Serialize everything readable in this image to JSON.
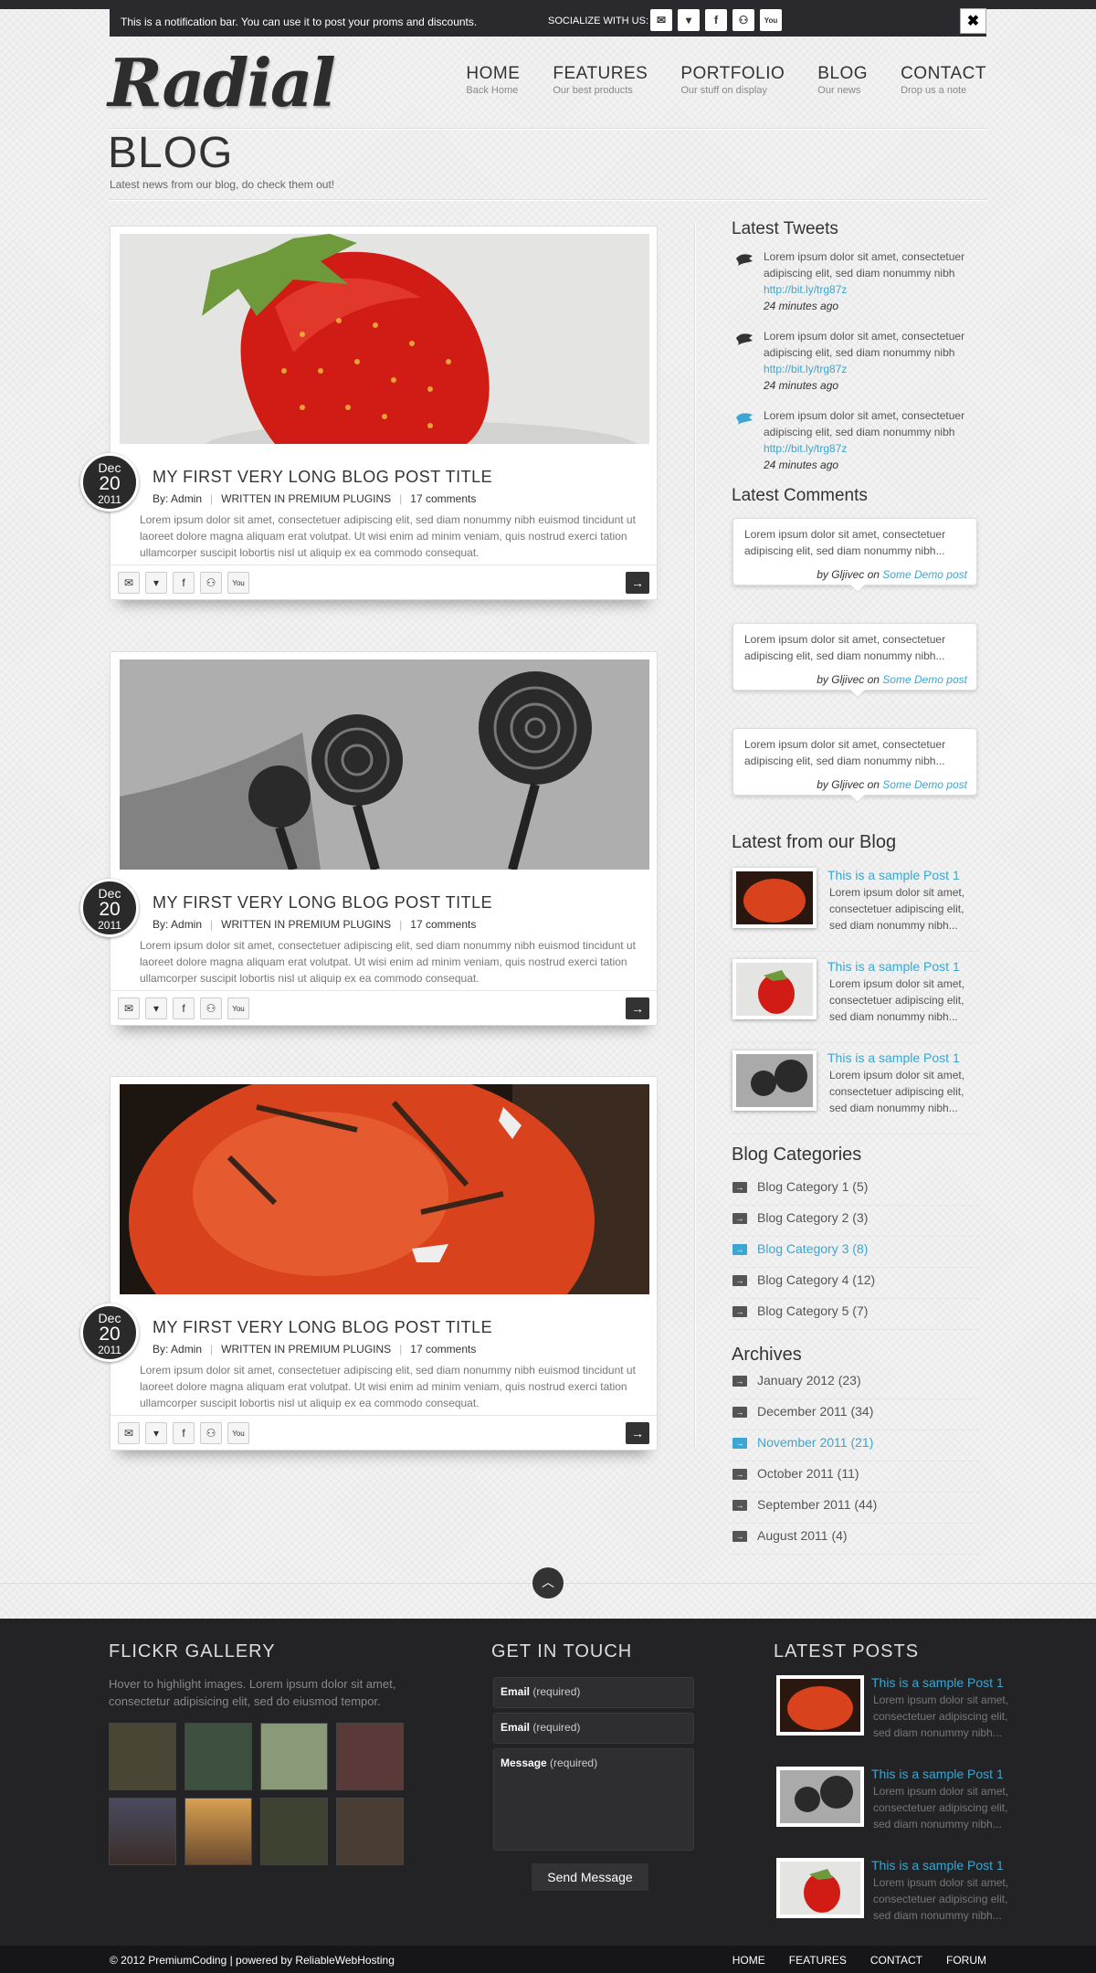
{
  "notification": {
    "text": "This is a notification bar. You can use it to post your proms and discounts.",
    "social_label": "SOCIALIZE WITH US:",
    "close": "✖"
  },
  "logo": "Radial",
  "nav": [
    {
      "title": "HOME",
      "sub": "Back Home"
    },
    {
      "title": "FEATURES",
      "sub": "Our best products"
    },
    {
      "title": "PORTFOLIO",
      "sub": "Our stuff on display"
    },
    {
      "title": "BLOG",
      "sub": "Our news"
    },
    {
      "title": "CONTACT",
      "sub": "Drop us a note"
    }
  ],
  "page": {
    "title": "BLOG",
    "subtitle": "Latest news from our blog, do check them out!"
  },
  "posts": [
    {
      "month": "Dec",
      "day": "20",
      "year": "2011",
      "title": "MY FIRST VERY LONG BLOG POST TITLE",
      "author": "By: Admin",
      "category": "WRITTEN IN PREMIUM PLUGINS",
      "comments": "17 comments",
      "excerpt": "Lorem ipsum dolor sit amet, consectetuer adipiscing elit, sed diam nonummy nibh euismod tincidunt ut laoreet dolore magna aliquam erat volutpat. Ut wisi enim ad minim veniam, quis nostrud exerci tation ullamcorper suscipit lobortis nisl ut aliquip ex ea commodo consequat.",
      "image": "strawberry"
    },
    {
      "month": "Dec",
      "day": "20",
      "year": "2011",
      "title": "MY FIRST VERY LONG BLOG POST TITLE",
      "author": "By: Admin",
      "category": "WRITTEN IN PREMIUM PLUGINS",
      "comments": "17 comments",
      "excerpt": "Lorem ipsum dolor sit amet, consectetuer adipiscing elit, sed diam nonummy nibh euismod tincidunt ut laoreet dolore magna aliquam erat volutpat. Ut wisi enim ad minim veniam, quis nostrud exerci tation ullamcorper suscipit lobortis nisl ut aliquip ex ea commodo consequat.",
      "image": "roses"
    },
    {
      "month": "Dec",
      "day": "20",
      "year": "2011",
      "title": "MY FIRST VERY LONG BLOG POST TITLE",
      "author": "By: Admin",
      "category": "WRITTEN IN PREMIUM PLUGINS",
      "comments": "17 comments",
      "excerpt": "Lorem ipsum dolor sit amet, consectetuer adipiscing elit, sed diam nonummy nibh euismod tincidunt ut laoreet dolore magna aliquam erat volutpat. Ut wisi enim ad minim veniam, quis nostrud exerci tation ullamcorper suscipit lobortis nisl ut aliquip ex ea commodo consequat.",
      "image": "tomato"
    }
  ],
  "sidebar": {
    "tweets_title": "Latest Tweets",
    "tweets": [
      {
        "text": "Lorem ipsum dolor sit amet, consectetuer adipiscing elit, sed diam nonummy nibh",
        "link": "http://bit.ly/trg87z",
        "time": "24 minutes ago"
      },
      {
        "text": "Lorem ipsum dolor sit amet, consectetuer adipiscing elit, sed diam nonummy nibh",
        "link": "http://bit.ly/trg87z",
        "time": "24 minutes ago"
      },
      {
        "text": "Lorem ipsum dolor sit amet, consectetuer adipiscing elit, sed diam nonummy nibh",
        "link": "http://bit.ly/trg87z",
        "time": "24 minutes ago"
      }
    ],
    "comments_title": "Latest Comments",
    "comments": [
      {
        "text": "Lorem ipsum dolor sit amet, consectetuer adipiscing elit, sed diam nonummy nibh...",
        "by": "by Gljivec on",
        "post": "Some Demo post"
      },
      {
        "text": "Lorem ipsum dolor sit amet, consectetuer adipiscing elit, sed diam nonummy nibh...",
        "by": "by Gljivec on",
        "post": "Some Demo post"
      },
      {
        "text": "Lorem ipsum dolor sit amet, consectetuer adipiscing elit, sed diam nonummy nibh...",
        "by": "by Gljivec on",
        "post": "Some Demo post"
      }
    ],
    "blog_title": "Latest from our Blog",
    "blog": [
      {
        "title": "This is a sample Post 1",
        "text": "Lorem ipsum dolor sit amet, consectetuer adipiscing elit, sed diam nonummy nibh...",
        "image": "tomato"
      },
      {
        "title": "This is a sample Post 1",
        "text": "Lorem ipsum dolor sit amet, consectetuer adipiscing elit, sed diam nonummy nibh...",
        "image": "strawberry"
      },
      {
        "title": "This is a sample Post 1",
        "text": "Lorem ipsum dolor sit amet, consectetuer adipiscing elit, sed diam nonummy nibh...",
        "image": "roses"
      }
    ],
    "categories_title": "Blog Categories",
    "categories": [
      {
        "label": "Blog Category 1 (5)",
        "active": false
      },
      {
        "label": "Blog Category 2 (3)",
        "active": false
      },
      {
        "label": "Blog Category 3 (8)",
        "active": true
      },
      {
        "label": "Blog Category 4 (12)",
        "active": false
      },
      {
        "label": "Blog Category 5 (7)",
        "active": false
      }
    ],
    "archives_title": "Archives",
    "archives": [
      {
        "label": "January 2012 (23)",
        "active": false
      },
      {
        "label": "December 2011 (34)",
        "active": false
      },
      {
        "label": "November 2011 (21)",
        "active": true
      },
      {
        "label": "October 2011 (11)",
        "active": false
      },
      {
        "label": "September 2011 (44)",
        "active": false
      },
      {
        "label": "August 2011 (4)",
        "active": false
      }
    ]
  },
  "footer": {
    "flickr_title": "FLICKR GALLERY",
    "flickr_desc": "Hover to highlight images. Lorem ipsum dolor sit amet, consectetur adipisicing elit, sed do eiusmod tempor.",
    "contact_title": "GET IN TOUCH",
    "email1_label": "Email",
    "email1_req": "(required)",
    "email2_label": "Email",
    "email2_req": "(required)",
    "message_label": "Message",
    "message_req": "(required)",
    "send": "Send Message",
    "posts_title": "LATEST POSTS",
    "posts": [
      {
        "title": "This is a sample Post 1",
        "text": "Lorem ipsum dolor sit amet, consectetuer adipiscing elit, sed diam nonummy nibh...",
        "image": "tomato"
      },
      {
        "title": "This is a sample Post 1",
        "text": "Lorem ipsum dolor sit amet, consectetuer adipiscing elit, sed diam nonummy nibh...",
        "image": "roses"
      },
      {
        "title": "This is a sample Post 1",
        "text": "Lorem ipsum dolor sit amet, consectetuer adipiscing elit, sed diam nonummy nibh...",
        "image": "strawberry"
      }
    ],
    "copyright": "© 2012 PremiumCoding | powered by ReliableWebHosting",
    "links": [
      "HOME",
      "FEATURES",
      "CONTACT",
      "FORUM"
    ]
  },
  "colors": {
    "accent": "#3aa6d1",
    "dark": "#232326",
    "twitter": "#3aa6d1"
  }
}
